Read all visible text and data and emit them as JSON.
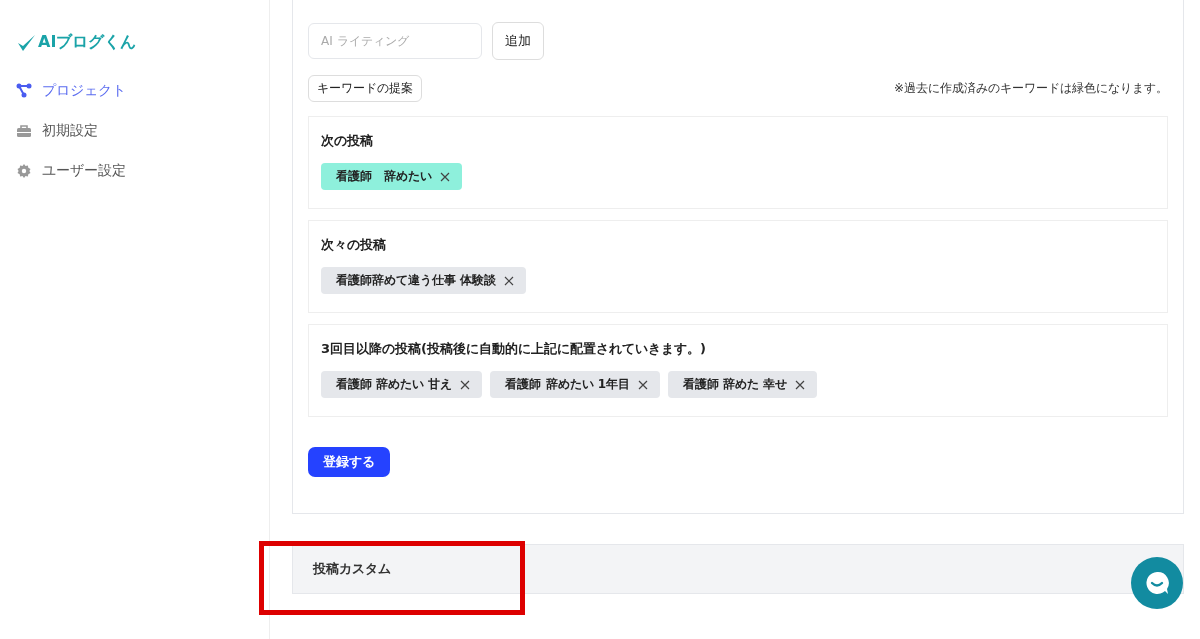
{
  "logo": {
    "text": "AIブログくん"
  },
  "sidebar": {
    "items": [
      {
        "label": "プロジェクト",
        "kind": "network",
        "selected": true
      },
      {
        "label": "初期設定",
        "kind": "toolbox",
        "selected": false
      },
      {
        "label": "ユーザー設定",
        "kind": "gear",
        "selected": false
      }
    ]
  },
  "keyword_input": {
    "placeholder": "AI ライティング"
  },
  "add_button": "追加",
  "suggest_button": "キーワードの提案",
  "note": "※過去に作成済みのキーワードは緑色になります。",
  "sections": [
    {
      "title": "次の投稿",
      "tags": [
        {
          "label": "看護師　辞めたい",
          "color": "#8ef0dc"
        }
      ]
    },
    {
      "title": "次々の投稿",
      "tags": [
        {
          "label": "看護師辞めて違う仕事 体験談",
          "color": "#e5e7eb"
        }
      ]
    },
    {
      "title": "3回目以降の投稿(投稿後に自動的に上記に配置されていきます。)",
      "tags": [
        {
          "label": "看護師 辞めたい 甘え",
          "color": "#e5e7eb"
        },
        {
          "label": "看護師 辞めたい 1年目",
          "color": "#e5e7eb"
        },
        {
          "label": "看護師 辞めた 幸せ",
          "color": "#e5e7eb"
        }
      ]
    }
  ],
  "submit_button": "登録する",
  "accordion": {
    "title": "投稿カスタム",
    "highlighted": true
  }
}
